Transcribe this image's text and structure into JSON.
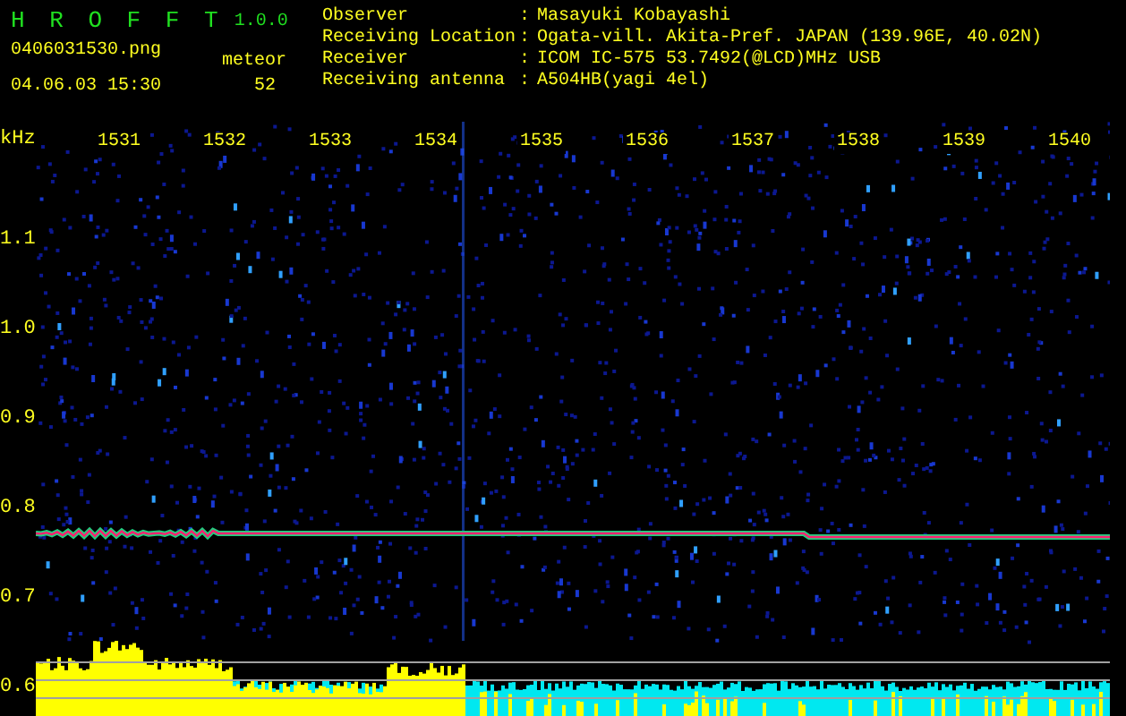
{
  "app": {
    "title": "H R O F F T",
    "version": "1.0.0",
    "filename": "0406031530.png",
    "timestamp": "04.06.03 15:30",
    "counter_label": "meteor",
    "counter_value": "52"
  },
  "station_info": [
    {
      "label": "Observer",
      "separator": ":",
      "value": "Masayuki Kobayashi"
    },
    {
      "label": "Receiving Location",
      "separator": ":",
      "value": "Ogata-vill. Akita-Pref. JAPAN (139.96E, 40.02N)"
    },
    {
      "label": "Receiver",
      "separator": ":",
      "value": "ICOM IC-575 53.7492(@LCD)MHz USB"
    },
    {
      "label": "Receiving antenna",
      "separator": ":",
      "value": "A504HB(yagi 4el)"
    }
  ],
  "spectrogram": {
    "unit": "kHz",
    "x_labels": [
      "1531",
      "1532",
      "1533",
      "1534",
      "1535",
      "1536",
      "1537",
      "1538",
      "1539",
      "1540"
    ],
    "y_labels": [
      "1.1",
      "1.0",
      "0.9",
      "0.8",
      "0.7",
      "0.6"
    ]
  }
}
